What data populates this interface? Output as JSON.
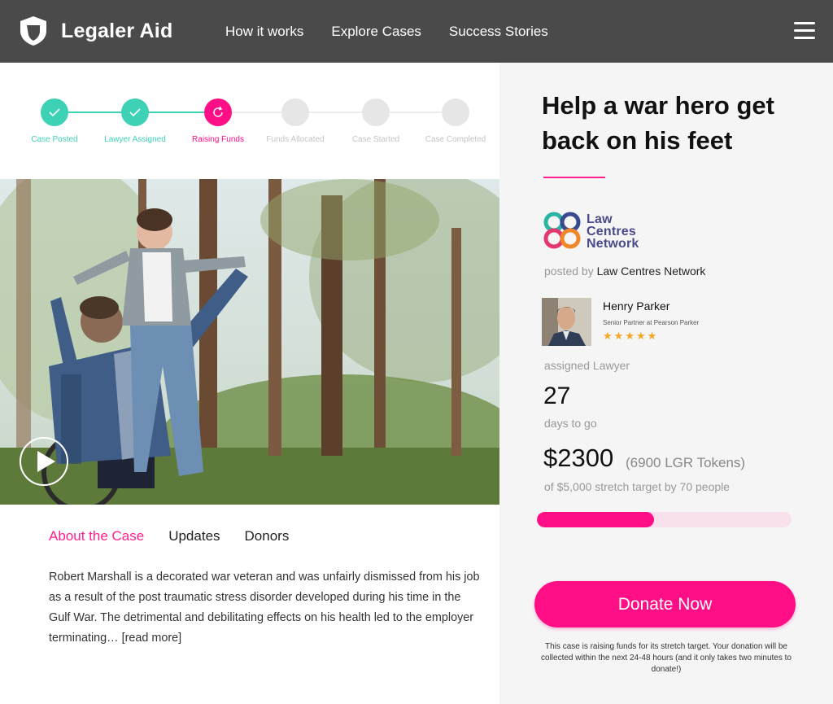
{
  "header": {
    "brand": "Legaler Aid",
    "nav": [
      "How it works",
      "Explore Cases",
      "Success Stories"
    ]
  },
  "steps": [
    {
      "label": "Case Posted",
      "state": "done"
    },
    {
      "label": "Lawyer Assigned",
      "state": "done"
    },
    {
      "label": "Raising Funds",
      "state": "current"
    },
    {
      "label": "Funds Allocated",
      "state": "pending"
    },
    {
      "label": "Case Started",
      "state": "pending"
    },
    {
      "label": "Case Completed",
      "state": "pending"
    }
  ],
  "tabs": [
    "About the Case",
    "Updates",
    "Donors"
  ],
  "story": {
    "text": "Robert Marshall is a decorated war veteran and was unfairly dismissed from his job as a result of the post traumatic stress disorder developed during his time in the Gulf War. The detrimental and debilitating effects on his health led to the employer terminating…",
    "read_more": "[read more]"
  },
  "case": {
    "title": "Help a war hero get back on his feet",
    "org_logo_text": [
      "Law",
      "Centres",
      "Network"
    ],
    "posted_prefix": "posted by",
    "posted_by": "Law Centres Network",
    "lawyer": {
      "name": "Henry Parker",
      "role": "Senior Partner at Pearson Parker",
      "rating": 5,
      "label": "assigned Lawyer"
    },
    "days": "27",
    "days_label": "days to go",
    "raised": "$2300",
    "tokens": "(6900 LGR Tokens)",
    "target_text": "of $5,000 stretch target by 70 people",
    "progress_fraction": 0.46,
    "donate_label": "Donate Now",
    "note": "This case is raising funds for its stretch target. Your donation will be collected within the next 24-48 hours (and it only takes two minutes to donate!)"
  },
  "colors": {
    "header_bg": "#4a4a4a",
    "accent": "#ff0e86",
    "teal": "#3dd1b6",
    "pending": "#e6e6e6"
  },
  "icons": {
    "brand": "shield-icon",
    "menu": "hamburger-menu-icon",
    "step_done": "check-icon",
    "step_current": "refresh-icon",
    "play": "play-icon",
    "star": "star-icon"
  }
}
